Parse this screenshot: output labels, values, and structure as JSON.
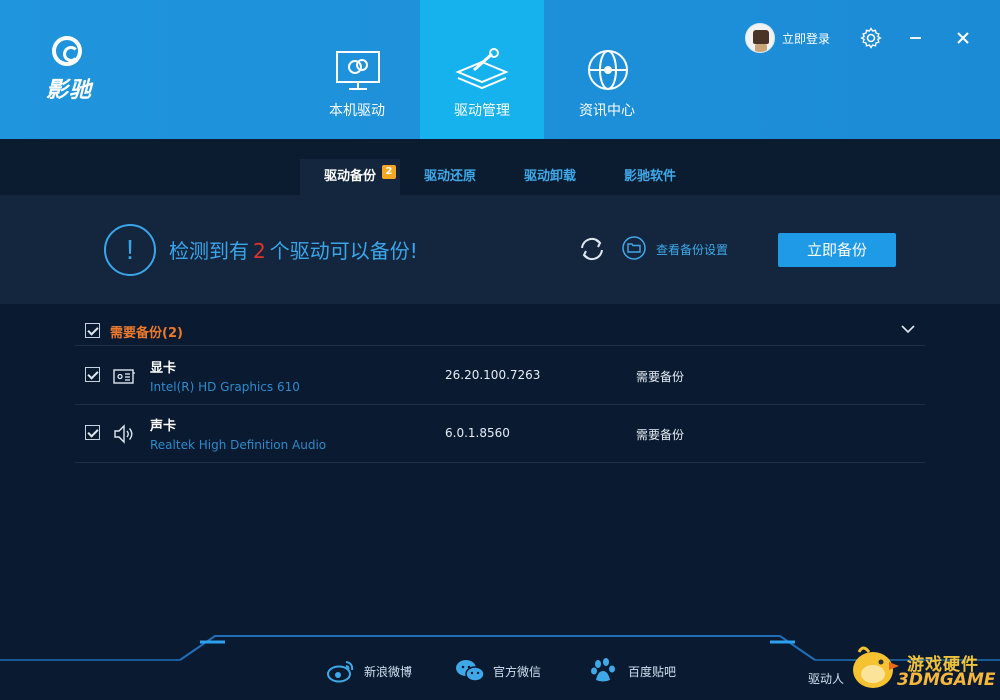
{
  "app": {
    "logo_text": "影驰"
  },
  "nav": {
    "tabs": [
      {
        "label": "本机驱动",
        "icon": "monitor-icon"
      },
      {
        "label": "驱动管理",
        "icon": "layers-wrench-icon",
        "active": true
      },
      {
        "label": "资讯中心",
        "icon": "globe-icon"
      }
    ]
  },
  "header": {
    "login_label": "立即登录",
    "settings_icon": "gear-icon",
    "minimize_icon": "minimize-icon",
    "close_icon": "close-icon"
  },
  "subtabs": {
    "items": [
      {
        "label": "驱动备份",
        "active": true,
        "badge": "2"
      },
      {
        "label": "驱动还原"
      },
      {
        "label": "驱动卸载"
      },
      {
        "label": "影驰软件"
      }
    ]
  },
  "banner": {
    "message_prefix": "检测到有",
    "count": "2",
    "message_suffix": "个驱动可以备份!",
    "view_settings_label": "查看备份设置",
    "backup_button_label": "立即备份"
  },
  "group": {
    "title": "需要备份(2)",
    "checked": true
  },
  "drivers": [
    {
      "name": "显卡",
      "desc": "Intel(R) HD Graphics 610",
      "version": "26.20.100.7263",
      "status": "需要备份",
      "icon": "graphics-card-icon",
      "checked": true
    },
    {
      "name": "声卡",
      "desc": "Realtek High Definition Audio",
      "version": "6.0.1.8560",
      "status": "需要备份",
      "icon": "speaker-icon",
      "checked": true
    }
  ],
  "footer": {
    "links": [
      {
        "label": "新浪微博",
        "icon": "weibo-icon"
      },
      {
        "label": "官方微信",
        "icon": "wechat-icon"
      },
      {
        "label": "百度贴吧",
        "icon": "baidu-tieba-icon"
      }
    ],
    "right_text": "驱动人"
  },
  "watermark": {
    "text1": "游戏硬件",
    "text2": "3DMGAME"
  },
  "colors": {
    "header_bg": "#1f95dd",
    "active_tab": "#16b2ee",
    "accent": "#3ba5eb",
    "warning": "#ec7a2d",
    "count_red": "#e2332b",
    "button": "#1e9ae6"
  }
}
